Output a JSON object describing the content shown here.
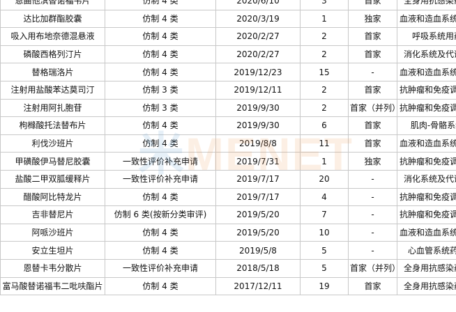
{
  "rows": [
    [
      "恩曲他滨替诺福韦片",
      "仿制 4 类",
      "2020/6/10",
      "3",
      "首家",
      "全身用抗感染药物"
    ],
    [
      "达比加群酯胶囊",
      "仿制 4 类",
      "2020/3/19",
      "1",
      "独家",
      "血液和造血系统药物"
    ],
    [
      "吸入用布地奈德混悬液",
      "仿制 4 类",
      "2020/2/27",
      "2",
      "首家",
      "呼吸系统用药"
    ],
    [
      "磷酸西格列汀片",
      "仿制 4 类",
      "2020/2/27",
      "2",
      "首家",
      "消化系统及代谢药"
    ],
    [
      "替格瑞洛片",
      "仿制 4 类",
      "2019/12/23",
      "15",
      "-",
      "血液和造血系统药物"
    ],
    [
      "注射用盐酸苯达莫司汀",
      "仿制 3 类",
      "2019/12/11",
      "2",
      "首家",
      "抗肿瘤和免疫调节剂"
    ],
    [
      "注射用阿扎胞苷",
      "仿制 3 类",
      "2019/9/30",
      "2",
      "首家（并列）",
      "抗肿瘤和免疫调节剂"
    ],
    [
      "枸橼酸托法替布片",
      "仿制 4 类",
      "2019/9/30",
      "6",
      "首家",
      "肌肉-骨骼系统"
    ],
    [
      "利伐沙班片",
      "仿制 4 类",
      "2019/8/8",
      "11",
      "首家",
      "血液和造血系统药物"
    ],
    [
      "甲磺酸伊马替尼胶囊",
      "一致性评价补充申请",
      "2019/7/31",
      "1",
      "独家",
      "抗肿瘤和免疫调节剂"
    ],
    [
      "盐酸二甲双胍缓释片",
      "一致性评价补充申请",
      "2019/7/17",
      "20",
      "-",
      "消化系统及代谢药"
    ],
    [
      "醋酸阿比特龙片",
      "仿制 4 类",
      "2019/7/17",
      "4",
      "-",
      "抗肿瘤和免疫调节剂"
    ],
    [
      "吉非替尼片",
      "仿制 6 类(按新分类审评)",
      "2019/5/20",
      "7",
      "-",
      "抗肿瘤和免疫调节剂"
    ],
    [
      "阿哌沙班片",
      "仿制 4 类",
      "2019/5/20",
      "10",
      "-",
      "血液和造血系统药物"
    ],
    [
      "安立生坦片",
      "仿制 4 类",
      "2019/5/8",
      "5",
      "-",
      "心血管系统药物"
    ],
    [
      "恩替卡韦分散片",
      "一致性评价补充申请",
      "2018/5/18",
      "5",
      "首家（并列）",
      "全身用抗感染药物"
    ],
    [
      "富马酸替诺福韦二吡呋酯片",
      "仿制 4 类",
      "2017/12/11",
      "19",
      "首家",
      "全身用抗感染药物"
    ]
  ],
  "watermark": {
    "part_a": "米",
    "part_b": "MENET"
  }
}
